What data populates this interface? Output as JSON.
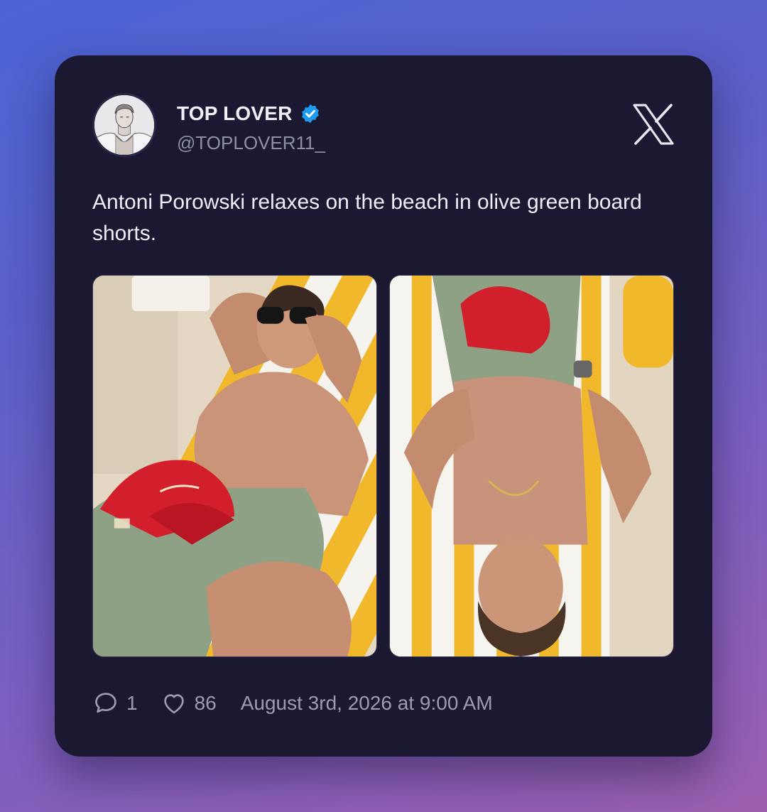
{
  "author": {
    "display_name": "TOP LOVER",
    "handle": "@TOPLOVER11_",
    "verified": true,
    "avatar_icon": "illustrated-man-avatar"
  },
  "platform": {
    "icon": "x-logo-icon"
  },
  "tweet": {
    "text": "Antoni Porowski relaxes on the beach in olive green board shorts."
  },
  "media": [
    {
      "icon": "photo-man-lounging-beach-chair"
    },
    {
      "icon": "photo-man-lying-on-striped-towel"
    }
  ],
  "stats": {
    "replies": "1",
    "likes": "86",
    "timestamp": "August 3rd, 2026 at 9:00 AM"
  },
  "colors": {
    "card_bg": "#1b1932",
    "verified_badge": "#1d9bf0",
    "text_primary": "#eceef5",
    "text_secondary": "#8e90a6"
  }
}
